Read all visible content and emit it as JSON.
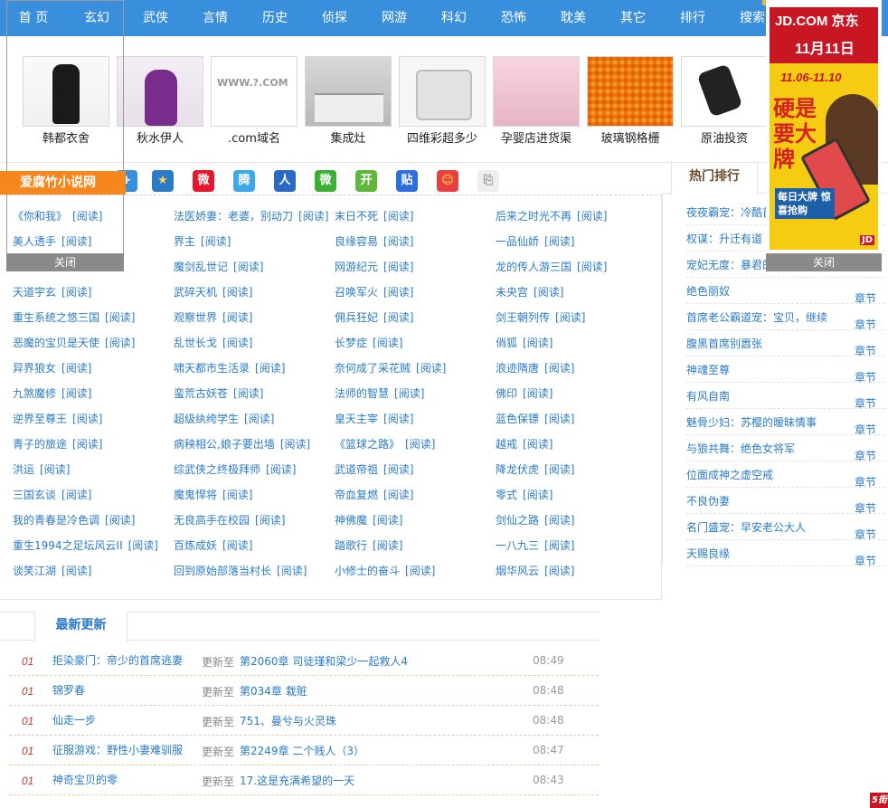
{
  "nav": [
    "首 页",
    "玄幻",
    "武侠",
    "言情",
    "历史",
    "侦探",
    "网游",
    "科幻",
    "恐怖",
    "耽美",
    "其它",
    "排行",
    "搜索"
  ],
  "strip": [
    "韩都衣舍",
    "秋水伊人",
    ".com域名",
    "集成灶",
    "四维彩超多少",
    "孕婴店进货渠",
    "玻璃钢格栅",
    "原油投资"
  ],
  "float_left": {
    "badge": "爱腐竹小说网",
    "close": "关闭"
  },
  "read_label": "[阅读]",
  "books": [
    [
      "《你和我》",
      "法医娇妻：老婆，别动刀",
      "末日不死",
      "后来之时光不再"
    ],
    [
      "美人透手",
      "界主",
      "良缘容易",
      "一品仙娇"
    ],
    [
      "",
      "魔剑乱世记",
      "网游纪元",
      "龙的传人游三国"
    ],
    [
      "天道宇玄",
      "武碎天机",
      "召唤军火",
      "未央宫"
    ],
    [
      "重生系统之悠三国",
      "观察世界",
      "佣兵狂妃",
      "剑王朝列传"
    ],
    [
      "恶魔的宝贝是天使",
      "乱世长戈",
      "长梦症",
      "俏狐"
    ],
    [
      "异界狼女",
      "啸天都市生活录",
      "奈何成了采花贼",
      "浪迹隋唐"
    ],
    [
      "九煞魔修",
      "蛮荒古妖苍",
      "法师的智慧",
      "佛印"
    ],
    [
      "逆界至尊王",
      "超级纨绔学生",
      "皇天主宰",
      "蓝色保镖"
    ],
    [
      "青子的旅途",
      "病秧相公,娘子要出墙",
      "《篮球之路》",
      "越戒"
    ],
    [
      "洪运",
      "综武侠之终极拜师",
      "武道帝祖",
      "降龙伏虎"
    ],
    [
      "三国玄谈",
      "魔鬼悍将",
      "帝血复燃",
      "零式"
    ],
    [
      "我的青春是冷色调",
      "无良高手在校园",
      "神佛魔",
      "剑仙之路"
    ],
    [
      "重生1994之足坛风云II",
      "百炼成妖",
      "踏歌行",
      "一八九三"
    ],
    [
      "谈笑江湖",
      "回到原始部落当村长",
      "小修士的奋斗",
      "烟华风云"
    ]
  ],
  "hot": {
    "tab": "热门排行",
    "tag": "章节",
    "items": [
      "夜夜霸宠：冷酷首",
      "权谋：升迁有道",
      "宠妃无度：暴君的",
      "绝色丽奴",
      "首席老公霸道宠：宝贝，继续",
      "腹黑首席别嚣张",
      "神魂至尊",
      "有风自南",
      "魅骨少妇：苏樱的暧昧情事",
      "与狼共舞：绝色女将军",
      "位面成神之虚空戒",
      "不良伪妻",
      "名门盛宠：早安老公大人",
      "天赐良缘"
    ]
  },
  "jd_ad": {
    "logo": "JD.COM 京东",
    "event": "11月11日",
    "dates": "11.06-11.10",
    "headline": "硬是要大牌",
    "sub": "每日大牌 惊喜抢购",
    "badge": "JD",
    "close": "关闭"
  },
  "latest": {
    "tab": "最新更新",
    "pre": "更新至",
    "rows": [
      {
        "idx": "01",
        "name": "拒染豪门：帝少的首席逃妻",
        "chapter": "第2060章 司徒瑾和梁少一起救人4",
        "time": "08:49"
      },
      {
        "idx": "01",
        "name": "锦罗春",
        "chapter": "第034章 栽赃",
        "time": "08:48"
      },
      {
        "idx": "01",
        "name": "仙走一步",
        "chapter": "751、曼兮与火灵珠",
        "time": "08:48"
      },
      {
        "idx": "01",
        "name": "征服游戏：野性小妻难驯服",
        "chapter": "第2249章 二个贱人（3）",
        "time": "08:47"
      },
      {
        "idx": "01",
        "name": "神奇宝贝的零",
        "chapter": "17.这是充满希望的一天",
        "time": "08:43"
      }
    ]
  },
  "corner_logo": "5街",
  "colors": {
    "nav": "#3a8fdc",
    "link": "#2a7bc8",
    "badge": "#f7861d",
    "jd_red": "#c81623"
  }
}
